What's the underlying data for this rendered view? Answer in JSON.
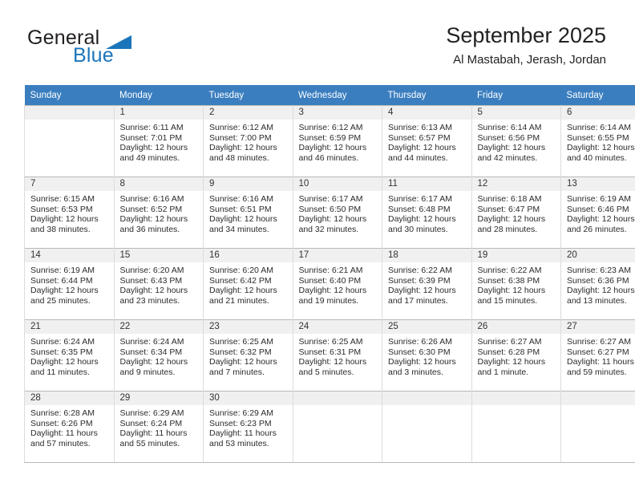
{
  "brand": {
    "name_part1": "General",
    "name_part2": "Blue",
    "triangle_icon": "triangle-icon",
    "accent_color": "#1b75bb"
  },
  "header": {
    "title": "September 2025",
    "subtitle": "Al Mastabah, Jerash, Jordan"
  },
  "calendar": {
    "header_bg": "#3a7ebf",
    "daynum_bg": "#f0f0f0",
    "columns": [
      "Sunday",
      "Monday",
      "Tuesday",
      "Wednesday",
      "Thursday",
      "Friday",
      "Saturday"
    ],
    "weeks": [
      [
        {
          "day": "",
          "empty": true
        },
        {
          "day": "1",
          "sunrise": "Sunrise: 6:11 AM",
          "sunset": "Sunset: 7:01 PM",
          "daylight": "Daylight: 12 hours and 49 minutes."
        },
        {
          "day": "2",
          "sunrise": "Sunrise: 6:12 AM",
          "sunset": "Sunset: 7:00 PM",
          "daylight": "Daylight: 12 hours and 48 minutes."
        },
        {
          "day": "3",
          "sunrise": "Sunrise: 6:12 AM",
          "sunset": "Sunset: 6:59 PM",
          "daylight": "Daylight: 12 hours and 46 minutes."
        },
        {
          "day": "4",
          "sunrise": "Sunrise: 6:13 AM",
          "sunset": "Sunset: 6:57 PM",
          "daylight": "Daylight: 12 hours and 44 minutes."
        },
        {
          "day": "5",
          "sunrise": "Sunrise: 6:14 AM",
          "sunset": "Sunset: 6:56 PM",
          "daylight": "Daylight: 12 hours and 42 minutes."
        },
        {
          "day": "6",
          "sunrise": "Sunrise: 6:14 AM",
          "sunset": "Sunset: 6:55 PM",
          "daylight": "Daylight: 12 hours and 40 minutes."
        }
      ],
      [
        {
          "day": "7",
          "sunrise": "Sunrise: 6:15 AM",
          "sunset": "Sunset: 6:53 PM",
          "daylight": "Daylight: 12 hours and 38 minutes."
        },
        {
          "day": "8",
          "sunrise": "Sunrise: 6:16 AM",
          "sunset": "Sunset: 6:52 PM",
          "daylight": "Daylight: 12 hours and 36 minutes."
        },
        {
          "day": "9",
          "sunrise": "Sunrise: 6:16 AM",
          "sunset": "Sunset: 6:51 PM",
          "daylight": "Daylight: 12 hours and 34 minutes."
        },
        {
          "day": "10",
          "sunrise": "Sunrise: 6:17 AM",
          "sunset": "Sunset: 6:50 PM",
          "daylight": "Daylight: 12 hours and 32 minutes."
        },
        {
          "day": "11",
          "sunrise": "Sunrise: 6:17 AM",
          "sunset": "Sunset: 6:48 PM",
          "daylight": "Daylight: 12 hours and 30 minutes."
        },
        {
          "day": "12",
          "sunrise": "Sunrise: 6:18 AM",
          "sunset": "Sunset: 6:47 PM",
          "daylight": "Daylight: 12 hours and 28 minutes."
        },
        {
          "day": "13",
          "sunrise": "Sunrise: 6:19 AM",
          "sunset": "Sunset: 6:46 PM",
          "daylight": "Daylight: 12 hours and 26 minutes."
        }
      ],
      [
        {
          "day": "14",
          "sunrise": "Sunrise: 6:19 AM",
          "sunset": "Sunset: 6:44 PM",
          "daylight": "Daylight: 12 hours and 25 minutes."
        },
        {
          "day": "15",
          "sunrise": "Sunrise: 6:20 AM",
          "sunset": "Sunset: 6:43 PM",
          "daylight": "Daylight: 12 hours and 23 minutes."
        },
        {
          "day": "16",
          "sunrise": "Sunrise: 6:20 AM",
          "sunset": "Sunset: 6:42 PM",
          "daylight": "Daylight: 12 hours and 21 minutes."
        },
        {
          "day": "17",
          "sunrise": "Sunrise: 6:21 AM",
          "sunset": "Sunset: 6:40 PM",
          "daylight": "Daylight: 12 hours and 19 minutes."
        },
        {
          "day": "18",
          "sunrise": "Sunrise: 6:22 AM",
          "sunset": "Sunset: 6:39 PM",
          "daylight": "Daylight: 12 hours and 17 minutes."
        },
        {
          "day": "19",
          "sunrise": "Sunrise: 6:22 AM",
          "sunset": "Sunset: 6:38 PM",
          "daylight": "Daylight: 12 hours and 15 minutes."
        },
        {
          "day": "20",
          "sunrise": "Sunrise: 6:23 AM",
          "sunset": "Sunset: 6:36 PM",
          "daylight": "Daylight: 12 hours and 13 minutes."
        }
      ],
      [
        {
          "day": "21",
          "sunrise": "Sunrise: 6:24 AM",
          "sunset": "Sunset: 6:35 PM",
          "daylight": "Daylight: 12 hours and 11 minutes."
        },
        {
          "day": "22",
          "sunrise": "Sunrise: 6:24 AM",
          "sunset": "Sunset: 6:34 PM",
          "daylight": "Daylight: 12 hours and 9 minutes."
        },
        {
          "day": "23",
          "sunrise": "Sunrise: 6:25 AM",
          "sunset": "Sunset: 6:32 PM",
          "daylight": "Daylight: 12 hours and 7 minutes."
        },
        {
          "day": "24",
          "sunrise": "Sunrise: 6:25 AM",
          "sunset": "Sunset: 6:31 PM",
          "daylight": "Daylight: 12 hours and 5 minutes."
        },
        {
          "day": "25",
          "sunrise": "Sunrise: 6:26 AM",
          "sunset": "Sunset: 6:30 PM",
          "daylight": "Daylight: 12 hours and 3 minutes."
        },
        {
          "day": "26",
          "sunrise": "Sunrise: 6:27 AM",
          "sunset": "Sunset: 6:28 PM",
          "daylight": "Daylight: 12 hours and 1 minute."
        },
        {
          "day": "27",
          "sunrise": "Sunrise: 6:27 AM",
          "sunset": "Sunset: 6:27 PM",
          "daylight": "Daylight: 11 hours and 59 minutes."
        }
      ],
      [
        {
          "day": "28",
          "sunrise": "Sunrise: 6:28 AM",
          "sunset": "Sunset: 6:26 PM",
          "daylight": "Daylight: 11 hours and 57 minutes."
        },
        {
          "day": "29",
          "sunrise": "Sunrise: 6:29 AM",
          "sunset": "Sunset: 6:24 PM",
          "daylight": "Daylight: 11 hours and 55 minutes."
        },
        {
          "day": "30",
          "sunrise": "Sunrise: 6:29 AM",
          "sunset": "Sunset: 6:23 PM",
          "daylight": "Daylight: 11 hours and 53 minutes."
        },
        {
          "day": "",
          "empty": true
        },
        {
          "day": "",
          "empty": true
        },
        {
          "day": "",
          "empty": true
        },
        {
          "day": "",
          "empty": true
        }
      ]
    ]
  }
}
